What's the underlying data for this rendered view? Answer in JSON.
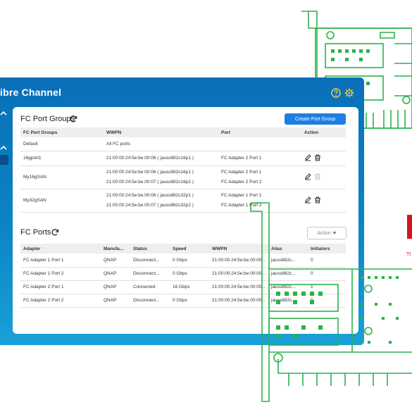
{
  "window": {
    "title": "ibre Channel"
  },
  "fc_port_groups": {
    "title": "FC Port Groups",
    "create_button": "Create Port Group",
    "columns": [
      "FC Port Groups",
      "WWPN",
      "Port",
      "Action"
    ],
    "rows": [
      {
        "group": "Default",
        "wwpn": [
          "All FC ports"
        ],
        "ports": [
          ""
        ]
      },
      {
        "group": "16gport1",
        "wwpn": [
          "21:00:00:24:5e:be:00:06 ( jauss882c16p1 )"
        ],
        "ports": [
          "FC Adapter 2 Port 1"
        ]
      },
      {
        "group": "My16gSAN",
        "wwpn": [
          "21:00:00:24:5e:be:00:06 ( jauss882c16p1 )",
          "21:00:00:24:5e:be:00:07 ( jauss882c16p2 )"
        ],
        "ports": [
          "FC Adapter 2 Port 1",
          "FC Adapter 2 Port 2"
        ]
      },
      {
        "group": "My32gSAN",
        "wwpn": [
          "21:00:00:24:5e:be:00:06 ( jauss882c32p1 )",
          "21:00:00:24:5e:be:00:07 ( jauss882c32p2 )"
        ],
        "ports": [
          "FC Adapter 1 Port 1",
          "FC Adapter 1 Port 2"
        ]
      }
    ]
  },
  "fc_ports": {
    "title": "FC Ports",
    "action_button": "Action",
    "columns": [
      "Adapter",
      "Manufa...",
      "Status",
      "Speed",
      "WWPN",
      "Alias",
      "Initiators"
    ],
    "rows": [
      [
        "FC Adapter 1 Port 1",
        "QNAP",
        "Disconnect...",
        "0 Gbps",
        "21:00:00:24:5e:be:00:00...",
        "jauss882c...",
        "0"
      ],
      [
        "FC Adapter 1 Port 2",
        "QNAP",
        "Disconnect...",
        "0 Gbps",
        "21:00:00:24:5e:be:00:00...",
        "jauss882c...",
        "0"
      ],
      [
        "FC Adapter 2 Port 1",
        "QNAP",
        "Connected",
        "16 Gbps",
        "21:00:00:24:5e:be:00:00...",
        "jauss882c...",
        "1"
      ],
      [
        "FC Adapter 2 Port 2",
        "QNAP",
        "Disconnect...",
        "0 Gbps",
        "21:00:00:24:5e:be:00:00...",
        "jauss882c...",
        "0"
      ]
    ]
  },
  "background": {
    "brand_text": "TI"
  },
  "colors": {
    "header": "#0b84c6",
    "primary": "#1e7fe0",
    "circuit": "#2bb24c",
    "icon_yellow": "#f3d23a",
    "brand_red": "#d8131c"
  },
  "icons": [
    "help-icon",
    "gear-icon",
    "refresh-icon",
    "edit-icon",
    "delete-icon",
    "chevron-up-icon",
    "chevron-down-icon"
  ]
}
